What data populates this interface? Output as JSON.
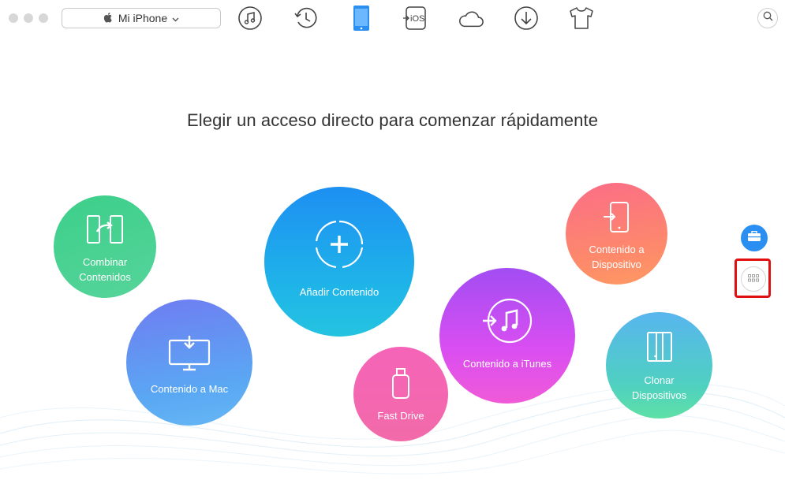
{
  "toolbar": {
    "device_name": "Mi iPhone",
    "tools": [
      "music-note-icon",
      "history-icon",
      "phone-icon",
      "to-ios-icon",
      "cloud-icon",
      "download-icon",
      "tshirt-icon"
    ],
    "ios_label": "iOS"
  },
  "main": {
    "headline": "Elegir un acceso directo para comenzar rápidamente"
  },
  "shortcuts": {
    "combinar_l1": "Combinar",
    "combinar_l2": "Contenidos",
    "mac": "Contenido a Mac",
    "anadir": "Añadir Contenido",
    "fastdrive": "Fast Drive",
    "itunes": "Contenido a iTunes",
    "dispositivo_l1": "Contenido a",
    "dispositivo_l2": "Dispositivo",
    "clonar": "Clonar Dispositivos"
  },
  "colors": {
    "accent_blue": "#2a8ff0",
    "highlight_red": "#e01010"
  }
}
